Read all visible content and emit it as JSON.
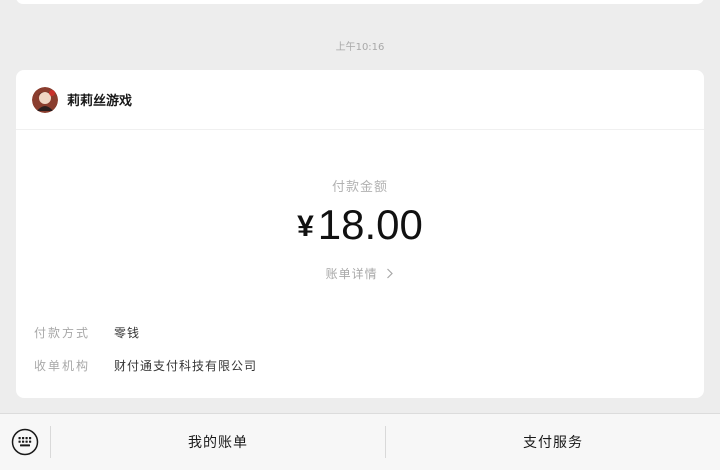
{
  "timestamp": "上午10:16",
  "merchant": {
    "name": "莉莉丝游戏",
    "avatar_icon": "merchant-avatar"
  },
  "payment": {
    "amount_label": "付款金额",
    "currency_symbol": "¥",
    "amount": "18.00",
    "detail_link": "账单详情"
  },
  "info": [
    {
      "key": "付款方式",
      "value": "零钱"
    },
    {
      "key": "收单机构",
      "value": "财付通支付科技有限公司"
    }
  ],
  "bottom_menu": {
    "keyboard_icon": "keyboard-icon",
    "items": [
      "我的账单",
      "支付服务"
    ]
  },
  "colors": {
    "background": "#ededed",
    "card": "#ffffff",
    "muted_text": "#a8a8a8"
  }
}
